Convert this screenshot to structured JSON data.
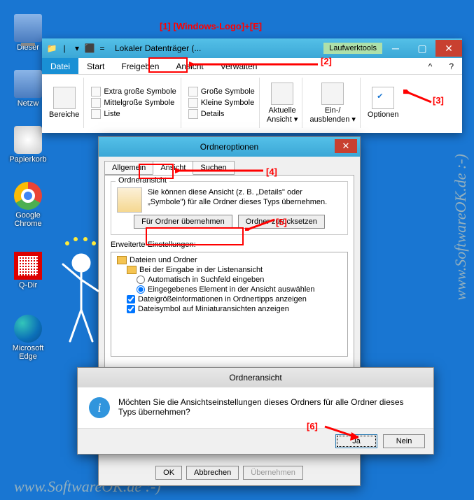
{
  "annotations": {
    "top": "[1]  [Windows-Logo]+[E]",
    "n2": "[2]",
    "n3": "[3]",
    "n4": "[4]",
    "n5": "[5]",
    "n6": "[6]"
  },
  "watermark": "www.SoftwareOK.de :-)",
  "desktop": {
    "dieser": "Dieser",
    "netzw": "Netzw",
    "papierkorb": "Papierkorb",
    "chrome": "Google Chrome",
    "qdir": "Q-Dir",
    "edge": "Microsoft Edge"
  },
  "explorer": {
    "title": "Lokaler Datenträger (...",
    "context": "Laufwerktools",
    "menu": {
      "datei": "Datei",
      "start": "Start",
      "freigeben": "Freigeben",
      "ansicht": "Ansicht",
      "verwalten": "Verwalten"
    },
    "ribbon": {
      "bereiche": "Bereiche",
      "views": {
        "xg": "Extra große Symbole",
        "gs": "Große Symbole",
        "ms": "Mittelgroße Symbole",
        "ks": "Kleine Symbole",
        "liste": "Liste",
        "details": "Details"
      },
      "aktuelleAnsicht": "Aktuelle\nAnsicht ▾",
      "einAus": "Ein-/\nausblenden ▾",
      "optionen": "Optionen"
    }
  },
  "folderOptions": {
    "title": "Ordneroptionen",
    "tabs": {
      "allgemein": "Allgemein",
      "ansicht": "Ansicht",
      "suchen": "Suchen"
    },
    "group1": {
      "title": "Ordneransicht",
      "desc": "Sie können diese Ansicht (z. B. „Details\" oder „Symbole\") für alle Ordner dieses Typs übernehmen.",
      "btnApply": "Für Ordner übernehmen",
      "btnReset": "Ordner zurücksetzen"
    },
    "adv": {
      "label": "Erweiterte Einstellungen:",
      "root": "Dateien und Ordner",
      "sub1": "Bei der Eingabe in der Listenansicht",
      "r1": "Automatisch in Suchfeld eingeben",
      "r2": "Eingegebenes Element in der Ansicht auswählen",
      "c1": "Dateigrößeinformationen in Ordnertipps anzeigen",
      "c2": "Dateisymbol auf Miniaturansichten anzeigen"
    },
    "buttons": {
      "ok": "OK",
      "cancel": "Abbrechen",
      "apply": "Übernehmen"
    }
  },
  "confirm": {
    "title": "Ordneransicht",
    "msg": "Möchten Sie die Ansichtseinstellungen dieses Ordners für alle Ordner dieses Typs übernehmen?",
    "yes": "Ja",
    "no": "Nein"
  }
}
